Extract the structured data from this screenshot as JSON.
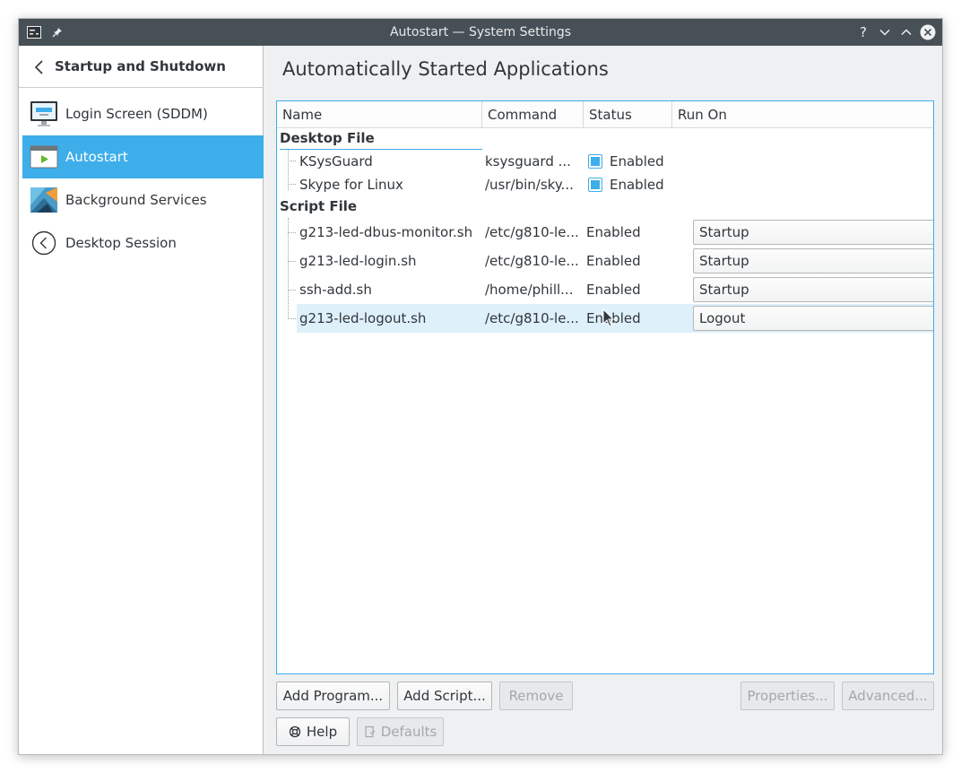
{
  "window": {
    "title": "Autostart — System Settings"
  },
  "sidebar": {
    "header": "Startup and Shutdown",
    "items": [
      {
        "label": "Login Screen (SDDM)",
        "icon": "monitor-icon"
      },
      {
        "label": "Autostart",
        "icon": "autostart-icon",
        "active": true
      },
      {
        "label": "Background Services",
        "icon": "services-icon"
      },
      {
        "label": "Desktop Session",
        "icon": "session-icon"
      }
    ]
  },
  "main": {
    "title": "Automatically Started Applications",
    "columns": [
      "Name",
      "Command",
      "Status",
      "Run On"
    ],
    "groups": [
      {
        "label": "Desktop File",
        "rows": [
          {
            "name": "KSysGuard",
            "command": "ksysguard ...",
            "status": "Enabled",
            "checked": true
          },
          {
            "name": "Skype for Linux",
            "command": "/usr/bin/sky...",
            "status": "Enabled",
            "checked": true
          }
        ]
      },
      {
        "label": "Script File",
        "rows": [
          {
            "name": "g213-led-dbus-monitor.sh",
            "command": "/etc/g810-le...",
            "status": "Enabled",
            "run_on": "Startup"
          },
          {
            "name": "g213-led-login.sh",
            "command": "/etc/g810-le...",
            "status": "Enabled",
            "run_on": "Startup"
          },
          {
            "name": "ssh-add.sh",
            "command": "/home/phill...",
            "status": "Enabled",
            "run_on": "Startup"
          },
          {
            "name": "g213-led-logout.sh",
            "command": "/etc/g810-le...",
            "status": "Enabled",
            "run_on": "Logout",
            "selected": true
          }
        ]
      }
    ],
    "buttons": {
      "add_program": "Add Program...",
      "add_script": "Add Script...",
      "remove": "Remove",
      "properties": "Properties...",
      "advanced": "Advanced...",
      "help": "Help",
      "defaults": "Defaults"
    }
  },
  "colors": {
    "accent": "#3daee9",
    "titlebar": "#475057",
    "selection": "#def0fa"
  }
}
